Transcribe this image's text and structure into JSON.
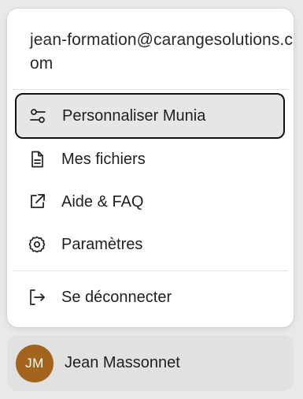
{
  "account": {
    "email": "jean-formation@carangesolutions.com"
  },
  "menu": {
    "items": [
      {
        "label": "Personnaliser Munia",
        "icon": "sliders-icon"
      },
      {
        "label": "Mes fichiers",
        "icon": "file-icon"
      },
      {
        "label": "Aide & FAQ",
        "icon": "external-link-icon"
      },
      {
        "label": "Paramètres",
        "icon": "gear-icon"
      }
    ],
    "logout": {
      "label": "Se déconnecter",
      "icon": "logout-icon"
    }
  },
  "user": {
    "initials": "JM",
    "name": "Jean Massonnet",
    "avatar_color": "#a3651e"
  }
}
